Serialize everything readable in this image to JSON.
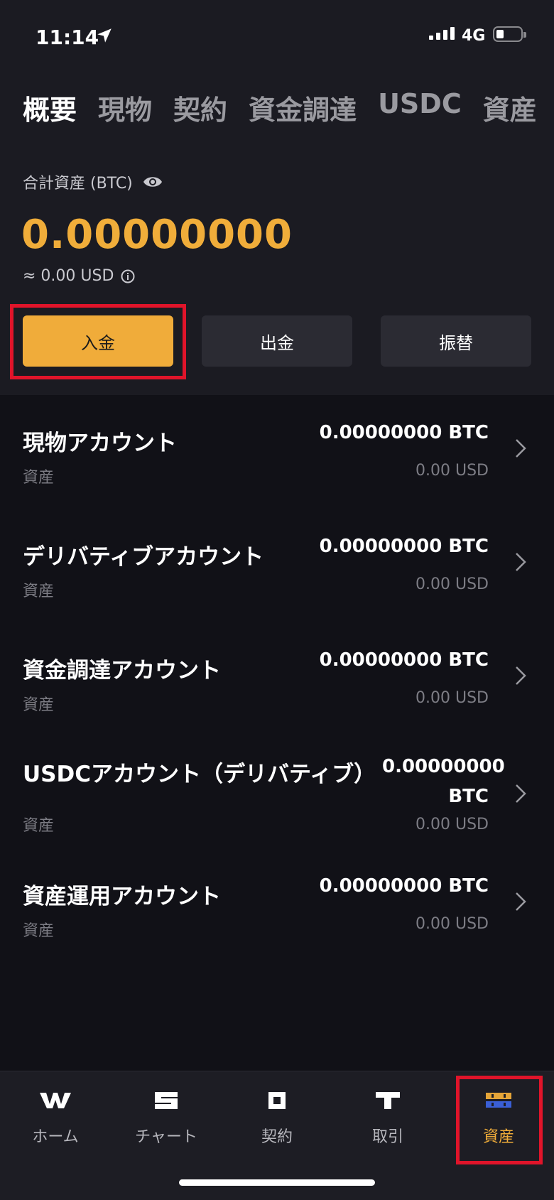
{
  "status_bar": {
    "time": "11:14",
    "network": "4G"
  },
  "tabs": [
    {
      "label": "概要"
    },
    {
      "label": "現物"
    },
    {
      "label": "契約"
    },
    {
      "label": "資金調達"
    },
    {
      "label": "USDC"
    },
    {
      "label": "資産"
    }
  ],
  "summary": {
    "total_label": "合計資産 (BTC)",
    "balance": "0.00000000",
    "approx_usd": "≈  0.00 USD"
  },
  "actions": {
    "deposit": "入金",
    "withdraw": "出金",
    "transfer": "振替"
  },
  "accounts": [
    {
      "name": "現物アカウント",
      "sub": "資産",
      "btc": "0.00000000 BTC",
      "usd": "0.00 USD"
    },
    {
      "name": "デリバティブアカウント",
      "sub": "資産",
      "btc": "0.00000000 BTC",
      "usd": "0.00 USD"
    },
    {
      "name": "資金調達アカウント",
      "sub": "資産",
      "btc": "0.00000000 BTC",
      "usd": "0.00 USD"
    },
    {
      "name": "USDCアカウント（デリバティブ）",
      "sub": "資産",
      "btc": "0.00000000 BTC",
      "usd": "0.00 USD"
    },
    {
      "name": "資産運用アカウント",
      "sub": "資産",
      "btc": "0.00000000 BTC",
      "usd": "0.00 USD"
    }
  ],
  "bottom_nav": [
    {
      "label": "ホーム",
      "icon": "w-logo-icon"
    },
    {
      "label": "チャート",
      "icon": "s-logo-icon"
    },
    {
      "label": "契約",
      "icon": "square-logo-icon"
    },
    {
      "label": "取引",
      "icon": "t-logo-icon"
    },
    {
      "label": "資産",
      "icon": "2022-logo-icon"
    }
  ],
  "colors": {
    "accent": "#f0ad3a",
    "highlight": "#e0142a",
    "background": "#111117",
    "panel": "#1b1b22"
  }
}
